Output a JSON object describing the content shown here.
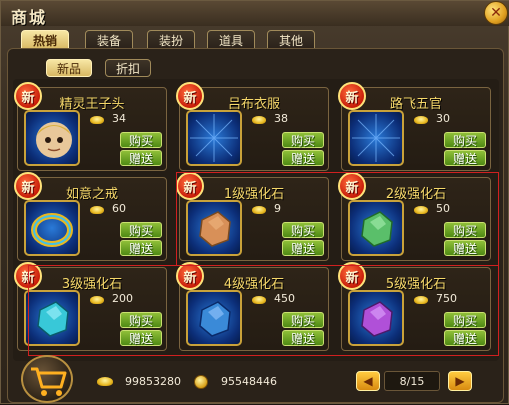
{
  "window": {
    "title": "商城",
    "close_icon": "✕"
  },
  "main_tabs": [
    {
      "label": "热销",
      "active": true
    },
    {
      "label": "装备",
      "active": false
    },
    {
      "label": "装扮",
      "active": false
    },
    {
      "label": "道具",
      "active": false
    },
    {
      "label": "其他",
      "active": false
    }
  ],
  "sub_tabs": [
    {
      "label": "新品",
      "active": true
    },
    {
      "label": "折扣",
      "active": false
    }
  ],
  "new_badge_text": "新",
  "buy_label": "购买",
  "gift_label": "赠送",
  "items": [
    {
      "name": "精灵王子头",
      "price": "34",
      "icon": "elf-head-icon",
      "new": true
    },
    {
      "name": "吕布衣服",
      "price": "38",
      "icon": "lubu-clothes-icon",
      "new": true
    },
    {
      "name": "路飞五官",
      "price": "30",
      "icon": "luffy-face-icon",
      "new": true
    },
    {
      "name": "如意之戒",
      "price": "60",
      "icon": "ring-icon",
      "new": true
    },
    {
      "name": "1级强化石",
      "price": "9",
      "icon": "stone-lv1-icon",
      "new": true
    },
    {
      "name": "2级强化石",
      "price": "50",
      "icon": "stone-lv2-icon",
      "new": true
    },
    {
      "name": "3级强化石",
      "price": "200",
      "icon": "stone-lv3-icon",
      "new": true
    },
    {
      "name": "4级强化石",
      "price": "450",
      "icon": "stone-lv4-icon",
      "new": true
    },
    {
      "name": "5级强化石",
      "price": "750",
      "icon": "stone-lv5-icon",
      "new": true
    }
  ],
  "footer": {
    "gold": "99853280",
    "coins": "95548446",
    "page": "8/15"
  },
  "colors": {
    "stone_lv1": "#d89058",
    "stone_lv2": "#5abf6a",
    "stone_lv3": "#38c8d8",
    "stone_lv4": "#3a8ad8",
    "stone_lv5": "#b050d8"
  }
}
